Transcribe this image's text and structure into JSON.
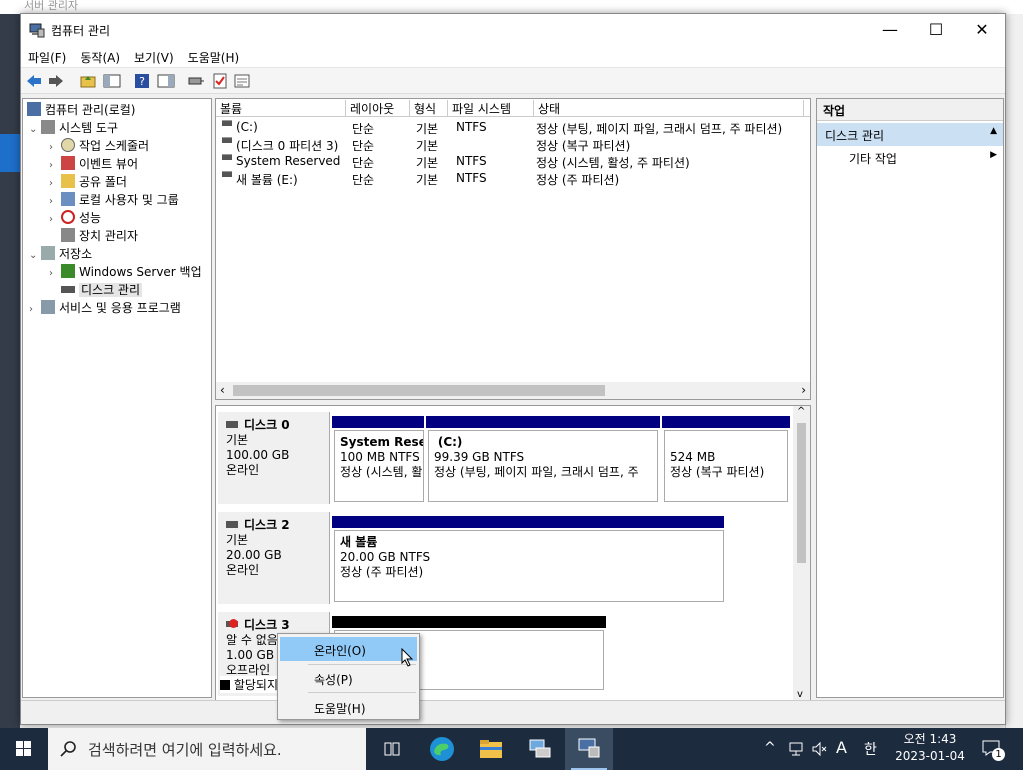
{
  "background": {
    "title": "서버 관리자"
  },
  "window": {
    "title": "컴퓨터 관리",
    "controls": {
      "minimize": "—",
      "maximize": "☐",
      "close": "✕"
    }
  },
  "menu": [
    "파일(F)",
    "동작(A)",
    "보기(V)",
    "도움말(H)"
  ],
  "tree": {
    "root": "컴퓨터 관리(로컬)",
    "system_tools": "시스템 도구",
    "task_scheduler": "작업 스케줄러",
    "event_viewer": "이벤트 뷰어",
    "shared_folders": "공유 폴더",
    "local_users": "로컬 사용자 및 그룹",
    "performance": "성능",
    "device_manager": "장치 관리자",
    "storage": "저장소",
    "windows_backup": "Windows Server 백업",
    "disk_management": "디스크 관리",
    "services_apps": "서비스 및 응용 프로그램"
  },
  "volume_list": {
    "columns": [
      "볼륨",
      "레이아웃",
      "형식",
      "파일 시스템",
      "상태"
    ],
    "rows": [
      [
        "(C:)",
        "단순",
        "기본",
        "NTFS",
        "정상 (부팅, 페이지 파일, 크래시 덤프, 주 파티션)"
      ],
      [
        "(디스크 0 파티션 3)",
        "단순",
        "기본",
        "",
        "정상 (복구 파티션)"
      ],
      [
        "System Reserved",
        "단순",
        "기본",
        "NTFS",
        "정상 (시스템, 활성, 주 파티션)"
      ],
      [
        "새 볼륨 (E:)",
        "단순",
        "기본",
        "NTFS",
        "정상 (주 파티션)"
      ]
    ]
  },
  "disks": {
    "disk0": {
      "name": "디스크 0",
      "type": "기본",
      "size": "100.00 GB",
      "status": "온라인",
      "p1": {
        "name": "System Reser",
        "size": "100 MB NTFS",
        "status": "정상 (시스템, 활"
      },
      "p2": {
        "name": "(C:)",
        "size": "99.39 GB NTFS",
        "status": "정상 (부팅, 페이지 파일, 크래시 덤프, 주"
      },
      "p3": {
        "size": "524 MB",
        "status": "정상 (복구 파티션)"
      }
    },
    "disk2": {
      "name": "디스크 2",
      "type": "기본",
      "size": "20.00 GB",
      "status": "온라인",
      "p1": {
        "name": "새 볼륨",
        "size": "20.00 GB NTFS",
        "status": "정상 (주 파티션)"
      }
    },
    "disk3": {
      "name": "디스크 3",
      "type": "알 수 없음",
      "size": "1.00 GB",
      "status": "오프라인"
    },
    "legend": "할당되지"
  },
  "actions": {
    "header": "작업",
    "section": "디스크 관리",
    "item": "기타 작업"
  },
  "context_menu": [
    "온라인(O)",
    "속성(P)",
    "도움말(H)"
  ],
  "taskbar": {
    "search_placeholder": "검색하려면 여기에 입력하세요.",
    "ime": "A",
    "ime_lang": "한",
    "time": "오전 1:43",
    "date": "2023-01-04",
    "notifications": "1"
  }
}
